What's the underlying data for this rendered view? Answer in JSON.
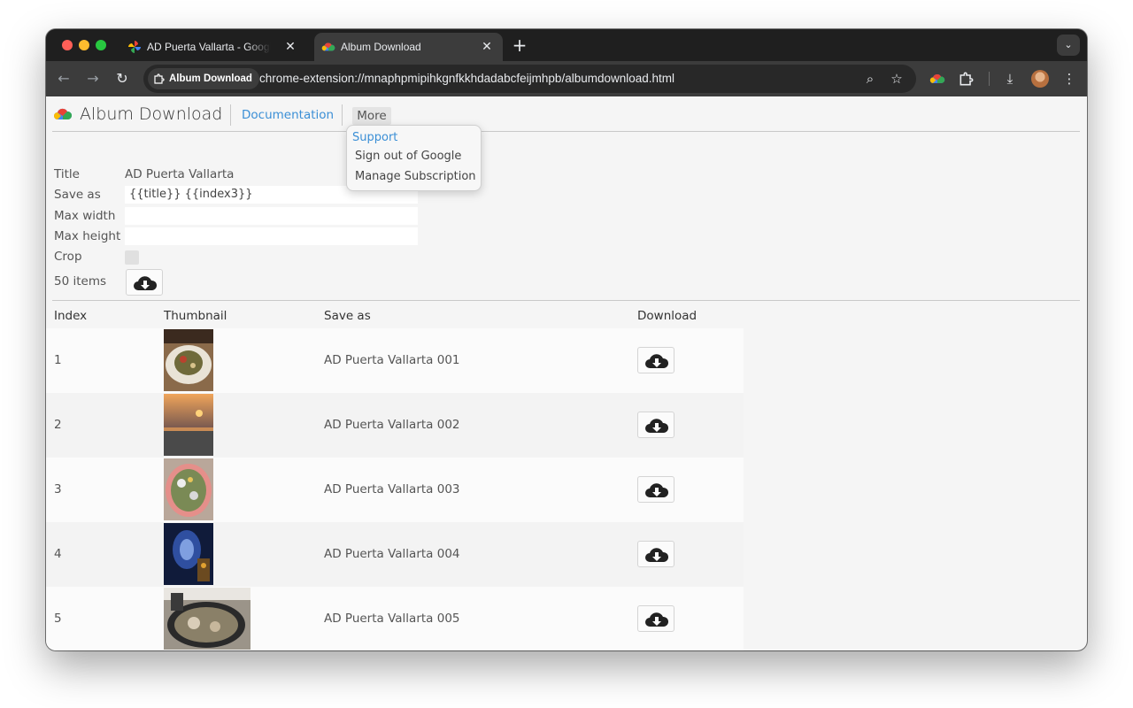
{
  "browser": {
    "tabs": [
      {
        "title": "AD Puerta Vallarta - Google Photos",
        "favicon": "google-photos-icon",
        "active": false
      },
      {
        "title": "Album Download",
        "favicon": "album-download-cloud-icon",
        "active": true
      }
    ],
    "site_chip": "Album Download",
    "url": "chrome-extension://mnaphpmipihkgnfkkhdadabcfeijmhpb/albumdownload.html"
  },
  "header": {
    "app_title": "Album Download",
    "documentation_label": "Documentation",
    "more_label": "More"
  },
  "more_menu": {
    "items": [
      "Support",
      "Sign out of Google",
      "Manage Subscription"
    ]
  },
  "form": {
    "title_label": "Title",
    "title_value": "AD Puerta Vallarta",
    "save_as_label": "Save as",
    "save_as_value": "{{title}} {{index3}}",
    "max_width_label": "Max width",
    "max_width_value": "",
    "max_height_label": "Max height",
    "max_height_value": "",
    "crop_label": "Crop",
    "crop_checked": false,
    "count_label": "50 items"
  },
  "table": {
    "headers": [
      "Index",
      "Thumbnail",
      "Save as",
      "Download"
    ],
    "rows": [
      {
        "index": "1",
        "save_as": "AD Puerta Vallarta 001"
      },
      {
        "index": "2",
        "save_as": "AD Puerta Vallarta 002"
      },
      {
        "index": "3",
        "save_as": "AD Puerta Vallarta 003"
      },
      {
        "index": "4",
        "save_as": "AD Puerta Vallarta 004"
      },
      {
        "index": "5",
        "save_as": "AD Puerta Vallarta 005"
      },
      {
        "index": "",
        "save_as": ""
      }
    ]
  },
  "colors": {
    "link": "#3b8fd6",
    "page_bg": "#f5f5f5",
    "chrome_dark": "#1f1f1f"
  }
}
